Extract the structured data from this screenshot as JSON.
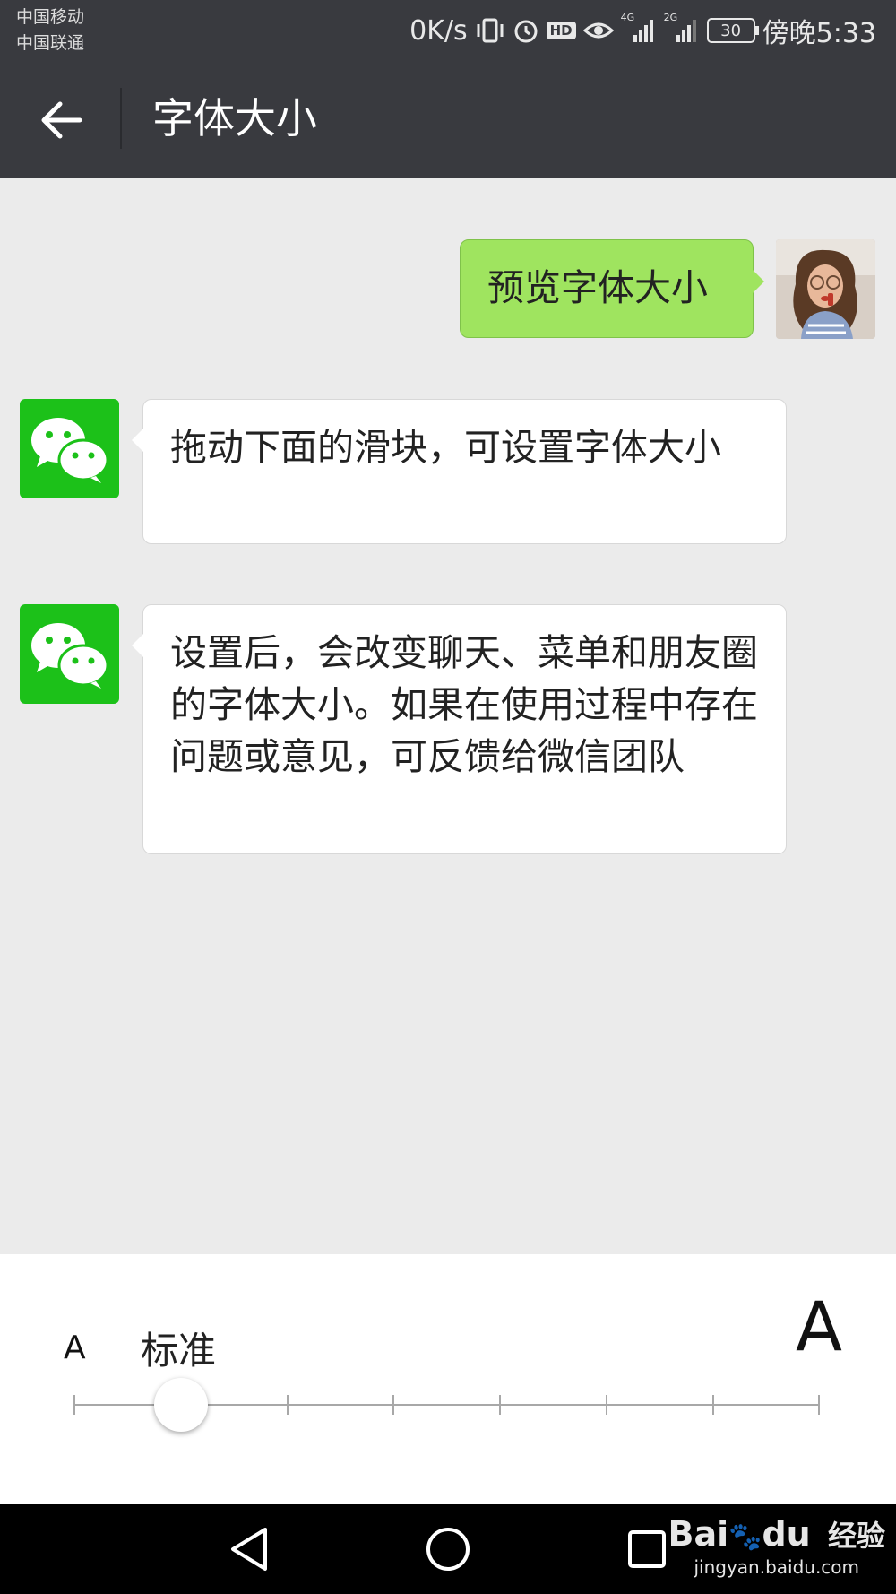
{
  "status_bar": {
    "carrier_1": "中国移动",
    "carrier_2": "中国联通",
    "net_speed": "0K/s",
    "network_1": "4G",
    "network_2": "2G",
    "battery": "30",
    "time": "傍晚5:33",
    "icons": [
      "vibrate-icon",
      "alarm-icon",
      "hd-icon",
      "eye-icon",
      "signal-icon",
      "signal-icon",
      "battery-icon"
    ]
  },
  "header": {
    "title": "字体大小",
    "back_icon": "back-arrow-icon"
  },
  "chat": {
    "messages": [
      {
        "side": "right",
        "text": "预览字体大小"
      },
      {
        "side": "left",
        "text": "拖动下面的滑块，可设置字体大小"
      },
      {
        "side": "left",
        "text": "设置后，会改变聊天、菜单和朋友圈的字体大小。如果在使用过程中存在问题或意见，可反馈给微信团队"
      }
    ]
  },
  "font_slider": {
    "small_label": "A",
    "large_label": "A",
    "level_label": "标准",
    "step_count": 8,
    "selected_step": 1
  },
  "nav_bar": {
    "buttons": [
      "back-triangle-icon",
      "home-circle-icon",
      "recents-square-icon"
    ]
  },
  "watermark": {
    "brand": "Bai",
    "brand_suffix": "du",
    "brand_cn": "经验",
    "url": "jingyan.baidu.com"
  },
  "colors": {
    "header_bg": "#393a3f",
    "chat_bg": "#ebebeb",
    "sent_bubble": "#9fe45f",
    "wechat_green": "#1cc119"
  }
}
